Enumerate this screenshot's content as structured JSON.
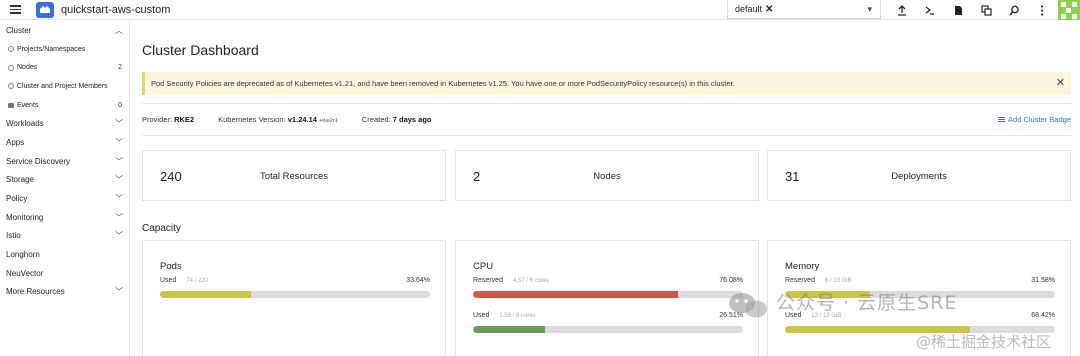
{
  "header": {
    "cluster_name": "quickstart-aws-custom",
    "namespace_chip": "default",
    "icons": [
      "upload-icon",
      "terminal-icon",
      "file-icon",
      "copy-icon",
      "search-icon",
      "more-vertical-icon"
    ]
  },
  "sidebar": {
    "group": "Cluster",
    "cluster_items": [
      {
        "label": "Projects/Namespaces",
        "icon": "namespace-icon",
        "count": ""
      },
      {
        "label": "Nodes",
        "icon": "node-icon",
        "count": "2"
      },
      {
        "label": "Cluster and Project Members",
        "icon": "members-icon",
        "count": ""
      },
      {
        "label": "Events",
        "icon": "folder-icon",
        "count": "0"
      }
    ],
    "sections": [
      {
        "label": "Workloads",
        "expandable": true
      },
      {
        "label": "Apps",
        "expandable": true
      },
      {
        "label": "Service Discovery",
        "expandable": true
      },
      {
        "label": "Storage",
        "expandable": true
      },
      {
        "label": "Policy",
        "expandable": true
      },
      {
        "label": "Monitoring",
        "expandable": true
      },
      {
        "label": "Istio",
        "expandable": true
      },
      {
        "label": "Longhorn",
        "expandable": false
      },
      {
        "label": "NeuVector",
        "expandable": false
      },
      {
        "label": "More Resources",
        "expandable": true
      }
    ]
  },
  "main": {
    "title": "Cluster Dashboard",
    "banner": "Pod Security Policies are deprecated as of Kubernetes v1.21, and have been removed in Kubernetes v1.25. You have one or more PodSecurityPolicy resource(s) in this cluster.",
    "provider_label": "Provider:",
    "provider_value": "RKE2",
    "version_label": "Kubernetes Version:",
    "version_value": "v1.24.14",
    "version_suffix": "+rke2r1",
    "created_label": "Created:",
    "created_value": "7 days ago",
    "add_badge": "Add Cluster Badge",
    "counts": [
      {
        "value": "240",
        "label": "Total Resources"
      },
      {
        "value": "2",
        "label": "Nodes"
      },
      {
        "value": "31",
        "label": "Deployments"
      }
    ],
    "capacity_title": "Capacity",
    "capacity": {
      "pods": {
        "title": "Pods",
        "used_label": "Used",
        "used_detail": "74 / 220",
        "used_pct": "33.64%",
        "used_fraction": 0.3364,
        "used_color": "#c9c44e"
      },
      "cpu": {
        "title": "CPU",
        "reserved_label": "Reserved",
        "reserved_detail": "4.57 / 6 cores",
        "reserved_pct": "76.08%",
        "reserved_fraction": 0.7608,
        "reserved_color": "#c75a4b",
        "used_label": "Used",
        "used_detail": "1.59 / 6 cores",
        "used_pct": "26.51%",
        "used_fraction": 0.2651,
        "used_color": "#6b9a5e"
      },
      "memory": {
        "title": "Memory",
        "reserved_label": "Reserved",
        "reserved_detail": "6 / 19 GiB",
        "reserved_pct": "31.58%",
        "reserved_fraction": 0.3158,
        "reserved_color": "#c9c44e",
        "used_label": "Used",
        "used_detail": "13 / 19 GiB",
        "used_pct": "68.42%",
        "used_fraction": 0.6842,
        "used_color": "#c9c44e"
      }
    }
  },
  "watermarks": {
    "wechat": "公众号 · 云原生SRE",
    "juejin": "@稀土掘金技术社区"
  }
}
